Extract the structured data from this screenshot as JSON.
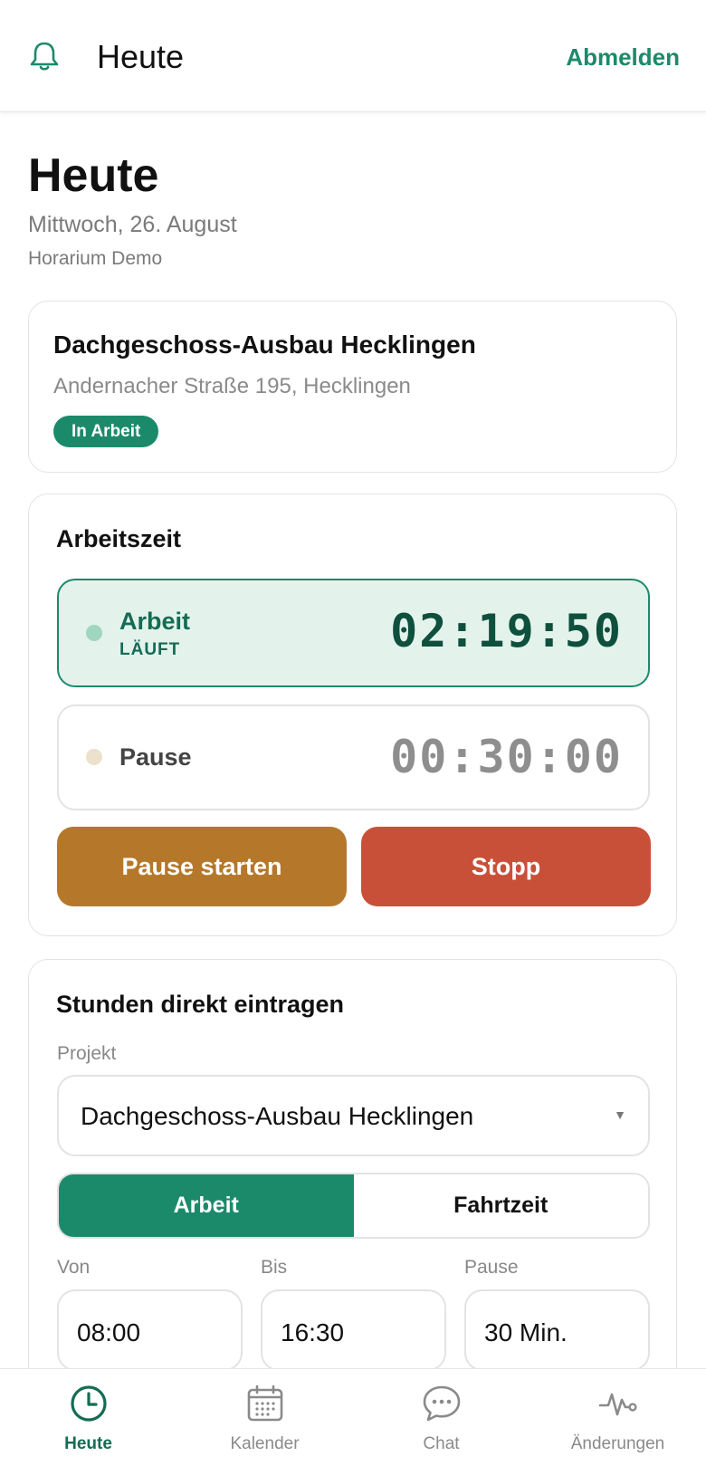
{
  "header": {
    "title": "Heute",
    "logout_label": "Abmelden"
  },
  "page": {
    "title": "Heute",
    "date": "Mittwoch, 26. August",
    "company": "Horarium Demo"
  },
  "project_card": {
    "name": "Dachgeschoss-Ausbau Hecklingen",
    "address": "Andernacher Straße 195, Hecklingen",
    "status": "In Arbeit"
  },
  "worktime": {
    "title": "Arbeitszeit",
    "work_label": "Arbeit",
    "work_status": "LÄUFT",
    "work_time": "02:19:50",
    "pause_label": "Pause",
    "pause_time": "00:30:00",
    "pause_button": "Pause starten",
    "stop_button": "Stopp"
  },
  "entry": {
    "title": "Stunden direkt eintragen",
    "project_label": "Projekt",
    "project_value": "Dachgeschoss-Ausbau Hecklingen",
    "segments": [
      "Arbeit",
      "Fahrtzeit"
    ],
    "from_label": "Von",
    "from_value": "08:00",
    "to_label": "Bis",
    "to_value": "16:30",
    "pause_label": "Pause",
    "pause_value": "30 Min."
  },
  "nav": {
    "items": [
      {
        "label": "Heute",
        "icon": "clock-icon"
      },
      {
        "label": "Kalender",
        "icon": "calendar-icon"
      },
      {
        "label": "Chat",
        "icon": "chat-icon"
      },
      {
        "label": "Änderungen",
        "icon": "activity-icon"
      }
    ]
  },
  "colors": {
    "accent": "#1b8a6b",
    "work_bg": "#e3f3ec",
    "pause_button": "#b5782a",
    "stop_button": "#c95038"
  }
}
